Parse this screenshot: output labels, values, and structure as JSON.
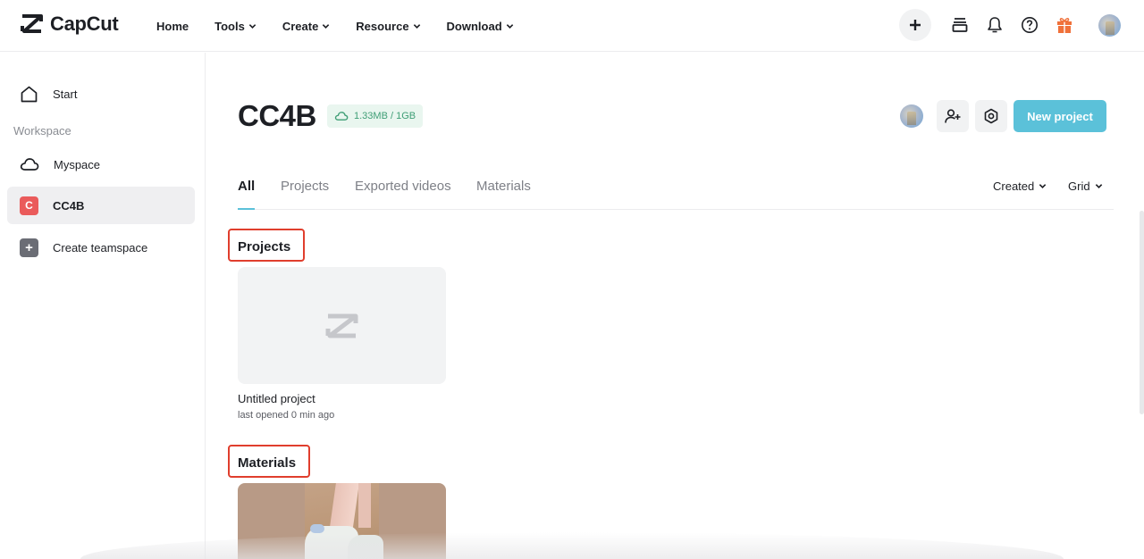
{
  "app": {
    "name": "CapCut"
  },
  "topnav": {
    "items": [
      {
        "label": "Home",
        "has_dropdown": false
      },
      {
        "label": "Tools",
        "has_dropdown": true
      },
      {
        "label": "Create",
        "has_dropdown": true
      },
      {
        "label": "Resource",
        "has_dropdown": true
      },
      {
        "label": "Download",
        "has_dropdown": true
      }
    ],
    "icons": [
      "plus-icon",
      "layers-icon",
      "bell-icon",
      "help-icon",
      "gift-icon",
      "user-avatar"
    ]
  },
  "sidebar": {
    "start_label": "Start",
    "section_label": "Workspace",
    "items": [
      {
        "label": "Myspace",
        "icon": "cloud-icon",
        "active": false
      },
      {
        "label": "CC4B",
        "badge": "C",
        "active": true
      },
      {
        "label": "Create teamspace",
        "badge": "+",
        "active": false
      }
    ]
  },
  "workspace": {
    "title": "CC4B",
    "storage": "1.33MB / 1GB",
    "new_project_label": "New project"
  },
  "tabs": [
    {
      "label": "All",
      "active": true
    },
    {
      "label": "Projects",
      "active": false
    },
    {
      "label": "Exported videos",
      "active": false
    },
    {
      "label": "Materials",
      "active": false
    }
  ],
  "sort": {
    "order_label": "Created",
    "view_label": "Grid"
  },
  "sections": {
    "projects": {
      "title": "Projects",
      "items": [
        {
          "title": "Untitled project",
          "subtitle": "last opened 0 min ago"
        }
      ]
    },
    "materials": {
      "title": "Materials"
    }
  },
  "colors": {
    "accent": "#5bc1d9",
    "storage_bg": "#e9f6ef",
    "storage_text": "#3f9e76",
    "highlight": "#e03e2d",
    "gift": "#f0713a",
    "workspace_badge": "#ea5b5b"
  }
}
